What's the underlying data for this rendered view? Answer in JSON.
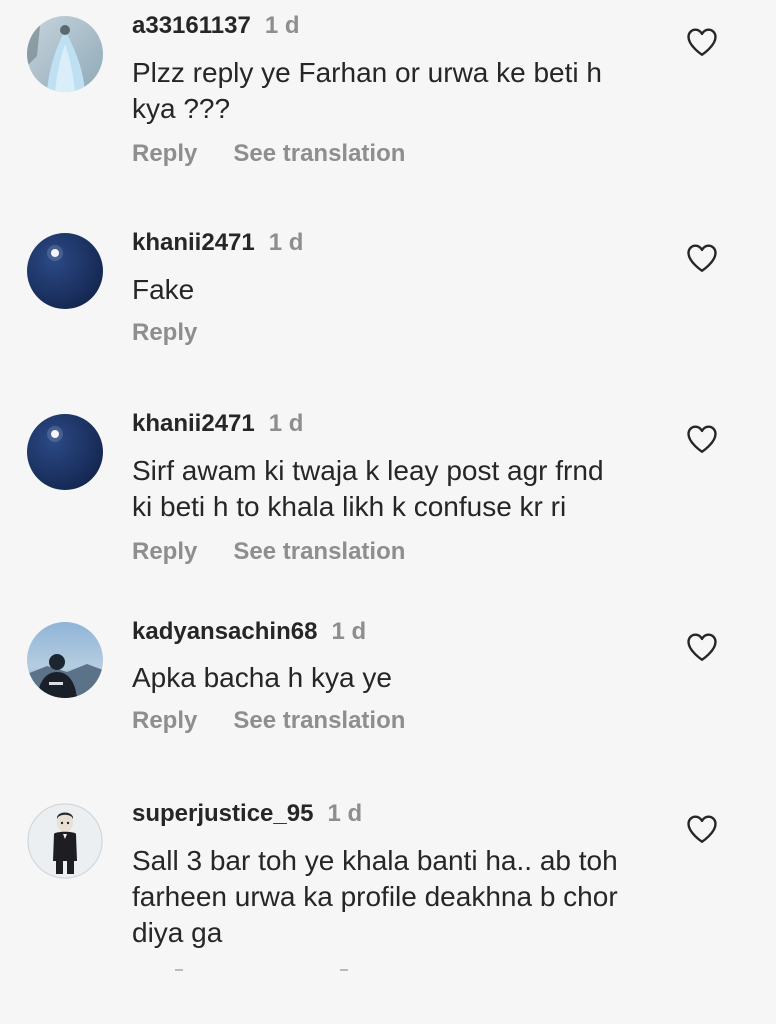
{
  "comments": [
    {
      "username": "a33161137",
      "time": "1 d",
      "lines": [
        "Plzz reply ye Farhan or urwa ke beti h",
        "kya ???"
      ],
      "reply": "Reply",
      "see_translation": "See translation",
      "avatar": "light-blue-photo",
      "like_icon": "heart-outline-icon"
    },
    {
      "username": "khanii2471",
      "time": "1 d",
      "lines": [
        "Fake"
      ],
      "reply": "Reply",
      "avatar": "night-moon-photo",
      "like_icon": "heart-outline-icon"
    },
    {
      "username": "khanii2471",
      "time": "1 d",
      "lines": [
        "Sirf awam ki twaja k leay post agr frnd",
        "ki beti h to khala likh k confuse kr ri"
      ],
      "reply": "Reply",
      "see_translation": "See translation",
      "avatar": "night-moon-photo",
      "like_icon": "heart-outline-icon"
    },
    {
      "username": "kadyansachin68",
      "time": "1 d",
      "lines": [
        "Apka bacha h kya ye"
      ],
      "reply": "Reply",
      "see_translation": "See translation",
      "avatar": "person-sky-photo",
      "like_icon": "heart-outline-icon"
    },
    {
      "username": "superjustice_95",
      "time": "1 d",
      "lines": [
        "Sall 3 bar toh ye khala banti ha.. ab toh",
        "farheen urwa ka profile deakhna b chor",
        "diya ga"
      ],
      "avatar": "cartoon-person",
      "like_icon": "heart-outline-icon"
    }
  ],
  "colors": {
    "background": "#f6f6f6",
    "text": "#262626",
    "muted": "#8e8e8e"
  }
}
